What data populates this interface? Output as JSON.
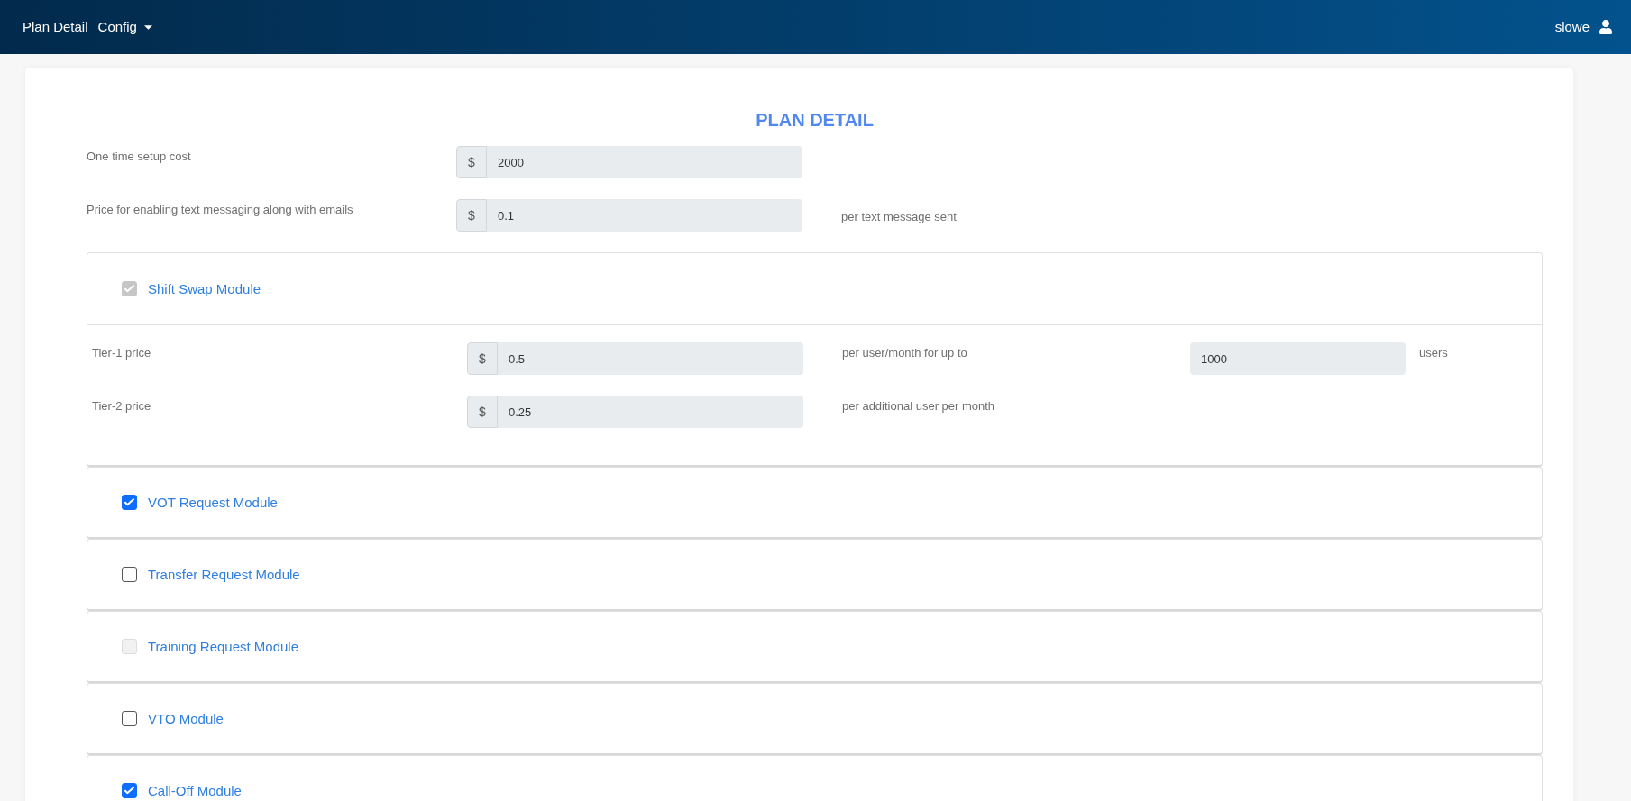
{
  "header": {
    "title": "Plan Detail",
    "menu": {
      "label": "Config"
    },
    "user": "slowe"
  },
  "page_title": "PLAN DETAIL",
  "pricing": [
    {
      "label": "One time setup cost",
      "prefix": "$",
      "value": "2000"
    },
    {
      "label": "Price for enabling text messaging along with emails",
      "prefix": "$",
      "value": "0.1",
      "suffix": "per text message sent"
    }
  ],
  "modules": [
    {
      "name": "Shift Swap Module",
      "checked": true,
      "disabled": true,
      "tiers": [
        {
          "label": "Tier-1 price",
          "prefix": "$",
          "value": "0.5",
          "suffix": "per user/month for up to",
          "limit": "1000",
          "limit_unit": "users"
        },
        {
          "label": "Tier-2 price",
          "prefix": "$",
          "value": "0.25",
          "suffix": "per additional user per month"
        }
      ]
    },
    {
      "name": "VOT Request Module",
      "checked": true,
      "disabled": false
    },
    {
      "name": "Transfer Request Module",
      "checked": false,
      "disabled": false
    },
    {
      "name": "Training Request Module",
      "checked": false,
      "disabled": true
    },
    {
      "name": "VTO Module",
      "checked": false,
      "disabled": false
    },
    {
      "name": "Call-Off Module",
      "checked": true,
      "disabled": false
    }
  ]
}
